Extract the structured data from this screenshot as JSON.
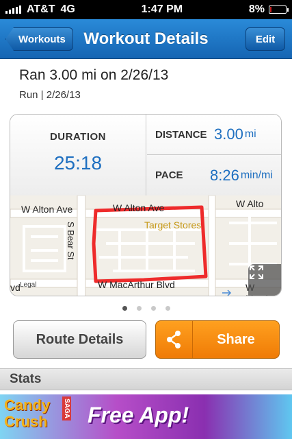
{
  "status_bar": {
    "carrier": "AT&T",
    "network": "4G",
    "time": "1:47 PM",
    "battery_percent": "8%",
    "battery_level": 0.08
  },
  "navbar": {
    "back_label": "Workouts",
    "title": "Workout Details",
    "edit_label": "Edit"
  },
  "summary": {
    "title": "Ran 3.00 mi on 2/26/13",
    "subtitle": "Run | 2/26/13"
  },
  "stats": {
    "duration_label": "DURATION",
    "duration_value": "25:18",
    "distance_label": "DISTANCE",
    "distance_value": "3.00",
    "distance_unit": "mi",
    "pace_label": "PACE",
    "pace_value": "8:26",
    "pace_unit": "min/mi"
  },
  "map": {
    "street_top_left": "W Alton Ave",
    "street_top_mid": "W Alton Ave",
    "street_top_right": "W Alto",
    "street_left_vertical": "S Bear St",
    "poi": "Target Stores",
    "street_bottom_left": "vd",
    "street_bottom_mid": "W MacArthur Blvd",
    "street_bottom_right": "W MacArth",
    "legal": "Legal",
    "route_color": "#ee2b2b"
  },
  "pager": {
    "count": 4,
    "active_index": 0
  },
  "buttons": {
    "route_details": "Route Details",
    "share": "Share"
  },
  "section": {
    "stats_header": "Stats"
  },
  "ad": {
    "brand_line1": "Candy",
    "brand_line2": "Crush",
    "brand_tag": "SAGA",
    "cta": "Free App!"
  },
  "colors": {
    "nav_blue": "#1a6fc2",
    "value_blue": "#1e6fc0",
    "share_orange": "#f28a0e"
  }
}
